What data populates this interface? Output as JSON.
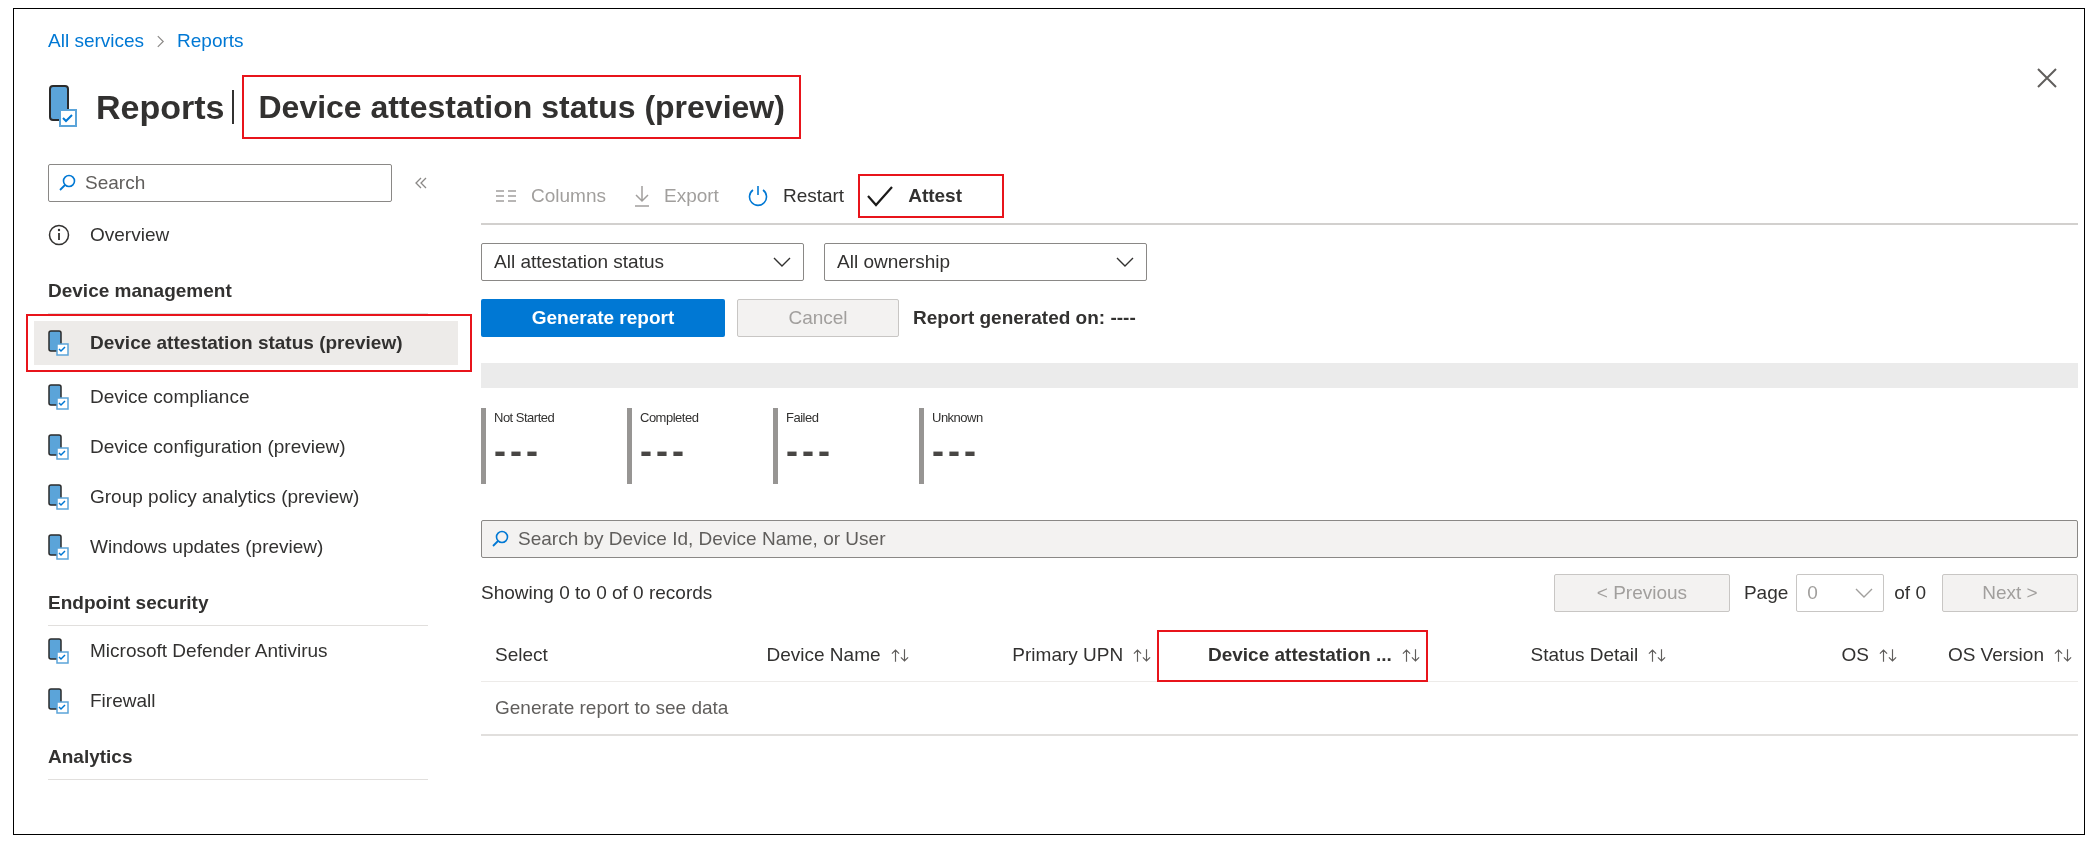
{
  "breadcrumb": [
    {
      "label": "All services"
    },
    {
      "label": "Reports"
    }
  ],
  "header": {
    "title": "Reports",
    "subtitle": "Device attestation status (preview)",
    "highlighted": true
  },
  "sidebar": {
    "search": {
      "placeholder": "Search"
    },
    "items": [
      {
        "kind": "info_link",
        "label": "Overview",
        "selected": false,
        "highlighted": false
      },
      {
        "kind": "heading",
        "label": "Device management"
      },
      {
        "kind": "device_link",
        "label": "Device attestation status (preview)",
        "selected": true,
        "highlighted": true
      },
      {
        "kind": "device_link",
        "label": "Device compliance",
        "selected": false,
        "highlighted": false
      },
      {
        "kind": "device_link",
        "label": "Device configuration (preview)",
        "selected": false,
        "highlighted": false
      },
      {
        "kind": "device_link",
        "label": "Group policy analytics (preview)",
        "selected": false,
        "highlighted": false
      },
      {
        "kind": "device_link",
        "label": "Windows updates (preview)",
        "selected": false,
        "highlighted": false
      },
      {
        "kind": "heading",
        "label": "Endpoint security"
      },
      {
        "kind": "device_link",
        "label": "Microsoft Defender Antivirus",
        "selected": false,
        "highlighted": false
      },
      {
        "kind": "device_link",
        "label": "Firewall",
        "selected": false,
        "highlighted": false
      },
      {
        "kind": "heading",
        "label": "Analytics"
      }
    ]
  },
  "toolbar": [
    {
      "kind": "columns",
      "label": "Columns",
      "disabled": true,
      "highlighted": false
    },
    {
      "kind": "export",
      "label": "Export",
      "disabled": true,
      "highlighted": false
    },
    {
      "kind": "restart",
      "label": "Restart",
      "disabled": false,
      "highlighted": false
    },
    {
      "kind": "attest",
      "label": "Attest",
      "disabled": false,
      "highlighted": true
    }
  ],
  "filters": [
    {
      "value": "All attestation status"
    },
    {
      "value": "All ownership"
    }
  ],
  "actions": [
    {
      "kind": "primary",
      "label": "Generate report"
    },
    {
      "kind": "secondary",
      "label": "Cancel",
      "disabled": true
    }
  ],
  "report_generated": {
    "label": "Report generated on:",
    "value": "----"
  },
  "stats": [
    {
      "label": "Not Started",
      "value": "---"
    },
    {
      "label": "Completed",
      "value": "---"
    },
    {
      "label": "Failed",
      "value": "---"
    },
    {
      "label": "Unknown",
      "value": "---"
    }
  ],
  "table_search": {
    "placeholder": "Search by Device Id, Device Name, or User"
  },
  "records": "Showing 0 to 0 of 0 records",
  "pagination": {
    "previous": {
      "label": "< Previous",
      "disabled": true
    },
    "page_label": "Page",
    "page_value": "0",
    "page_of": "of 0",
    "next": {
      "label": "Next >",
      "disabled": true
    }
  },
  "table": {
    "columns": [
      {
        "label": "Select",
        "sortable": false,
        "highlighted": false
      },
      {
        "label": "Device Name",
        "sortable": true,
        "highlighted": false
      },
      {
        "label": "Primary UPN",
        "sortable": true,
        "highlighted": false
      },
      {
        "label": "Device attestation ...",
        "sortable": true,
        "highlighted": true
      },
      {
        "label": "Status Detail",
        "sortable": true,
        "highlighted": false
      },
      {
        "label": "OS",
        "sortable": true,
        "highlighted": false
      },
      {
        "label": "OS Version",
        "sortable": true,
        "highlighted": false
      }
    ],
    "empty_message": "Generate report to see data"
  }
}
